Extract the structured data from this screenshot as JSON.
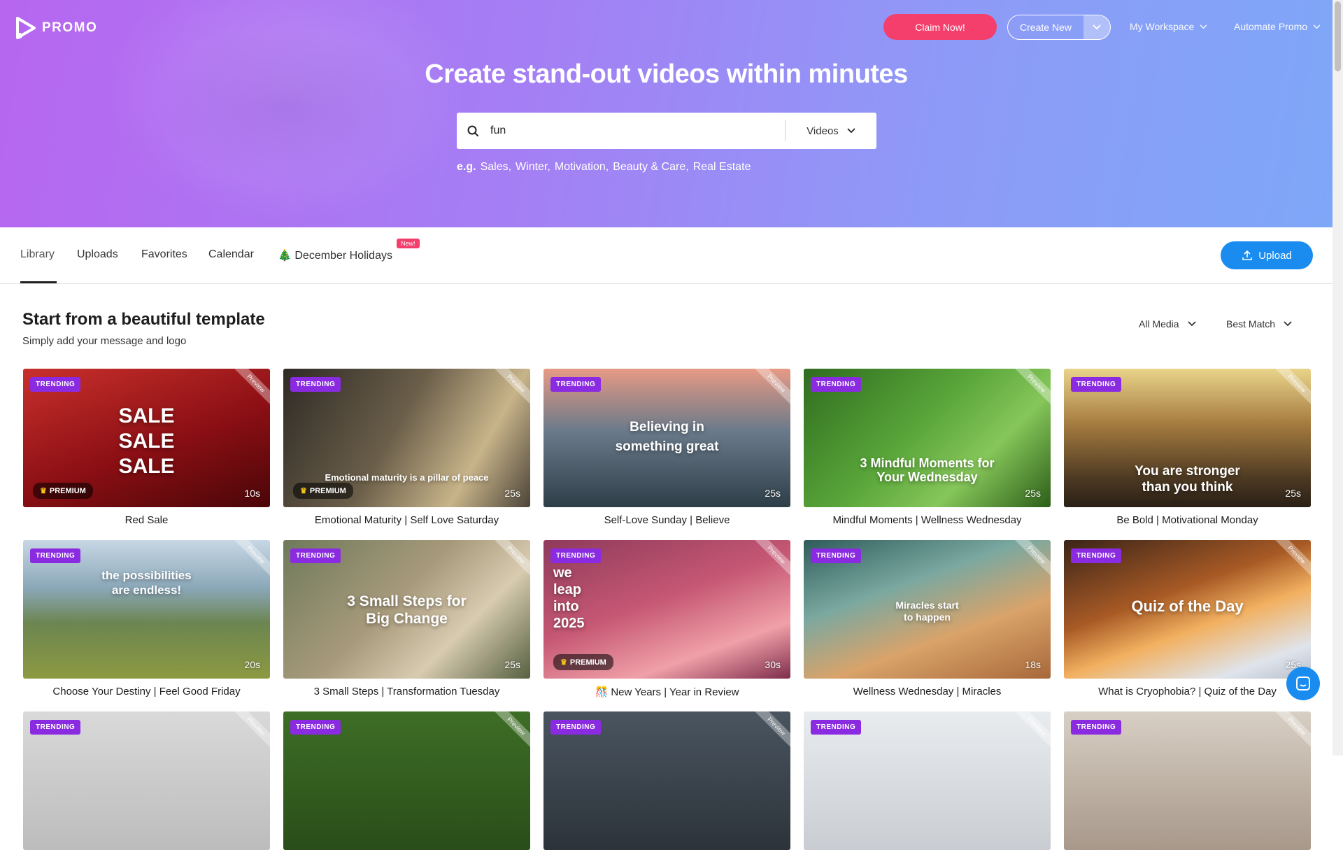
{
  "brand": {
    "name": "PROMO"
  },
  "header": {
    "claim": "Claim Now!",
    "create": "Create New",
    "workspace": "My Workspace",
    "automate": "Automate Promo"
  },
  "hero": {
    "title": "Create stand-out videos within minutes"
  },
  "search": {
    "value": "fun",
    "type": "Videos"
  },
  "examples": {
    "prefix": "e.g.",
    "items": [
      "Sales,",
      "Winter,",
      "Motivation,",
      "Beauty & Care,",
      "Real Estate"
    ]
  },
  "tabs": [
    {
      "label": "Library"
    },
    {
      "label": "Uploads"
    },
    {
      "label": "Favorites"
    },
    {
      "label": "Calendar"
    },
    {
      "label": "🎄 December Holidays"
    }
  ],
  "new_badge": "New!",
  "upload": "Upload",
  "section": {
    "title": "Start from a beautiful template",
    "subtitle": "Simply add your message and logo"
  },
  "filters": {
    "media": "All Media",
    "sort": "Best Match"
  },
  "badges": {
    "trending": "TRENDING",
    "premium": "PREMIUM",
    "preview": "Preview"
  },
  "templates": [
    {
      "title": "Red Sale",
      "duration": "10s",
      "overlay": "SALE\nSALE\nSALE",
      "premium": true,
      "bg": "linear-gradient(160deg,#c9302c 0%,#8b0f14 55%,#4a0608 100%)"
    },
    {
      "title": "Emotional Maturity | Self Love Saturday",
      "duration": "25s",
      "overlay": "Emotional maturity is a pillar of peace",
      "premium": true,
      "bg": "linear-gradient(120deg,#2e2a25 0%,#6b5f4a 45%,#c8b48a 75%,#4c4438 100%)"
    },
    {
      "title": "Self-Love Sunday | Believe",
      "duration": "25s",
      "overlay": "Believing in\nsomething great",
      "premium": false,
      "bg": "linear-gradient(180deg,#e79a85 0%,#6a7a8a 45%,#2e3e48 100%)"
    },
    {
      "title": "Mindful Moments | Wellness Wednesday",
      "duration": "25s",
      "overlay": "3 Mindful Moments for\nYour Wednesday",
      "premium": false,
      "bg": "linear-gradient(135deg,#2f6d1f 0%,#5aa63a 45%,#86c65a 70%,#2c5e18 100%)"
    },
    {
      "title": "Be Bold | Motivational Monday",
      "duration": "25s",
      "overlay": "You are stronger\nthan you think",
      "premium": false,
      "bg": "linear-gradient(180deg,#e9d48a 0%,#a57b3f 40%,#4b3822 80%,#2a2016 100%)"
    },
    {
      "title": "Choose Your Destiny | Feel Good Friday",
      "duration": "20s",
      "overlay": "the possibilities\nare endless!",
      "premium": false,
      "bg": "linear-gradient(180deg,#c7d7e4 0%,#8aa7b8 35%,#6c8550 60%,#8d9a42 100%)"
    },
    {
      "title": "3 Small Steps | Transformation Tuesday",
      "duration": "25s",
      "overlay": "3 Small Steps for\nBig Change",
      "premium": false,
      "bg": "linear-gradient(135deg,#6e7a5a 0%,#a89a7c 45%,#d8cbb0 70%,#556040 100%)"
    },
    {
      "title": "🎊 New Years | Year in Review",
      "duration": "30s",
      "overlay": "we\nleap\ninto\n2025",
      "premium": true,
      "bg": "linear-gradient(160deg,#8f3a5b 0%,#c65874 45%,#f0a0a8 75%,#7e2d4b 100%)"
    },
    {
      "title": "Wellness Wednesday | Miracles",
      "duration": "18s",
      "overlay": "Miracles start\nto happen",
      "premium": false,
      "bg": "linear-gradient(160deg,#2f5c5a 0%,#7aa8a0 35%,#d9a36a 65%,#a8683a 100%)"
    },
    {
      "title": "What is Cryophobia? | Quiz of the Day",
      "duration": "25s",
      "overlay": "Quiz of the Day",
      "premium": false,
      "bg": "linear-gradient(160deg,#3a2418 0%,#a85a25 40%,#f2b060 60%,#dfe4ec 85%,#b8c0cc 100%)"
    },
    {
      "title": "",
      "duration": "",
      "overlay": "",
      "premium": false,
      "bg": "linear-gradient(180deg,#d9d9d9 0%,#bcbcbc 100%)"
    },
    {
      "title": "",
      "duration": "",
      "overlay": "",
      "premium": false,
      "bg": "linear-gradient(180deg,#3d6e26 0%,#2a4d19 100%)"
    },
    {
      "title": "",
      "duration": "",
      "overlay": "",
      "premium": false,
      "bg": "linear-gradient(180deg,#4a5560 0%,#2c333a 100%)"
    },
    {
      "title": "",
      "duration": "",
      "overlay": "",
      "premium": false,
      "bg": "linear-gradient(180deg,#e9ecef 0%,#c9cdd2 100%)"
    },
    {
      "title": "",
      "duration": "",
      "overlay": "",
      "premium": false,
      "bg": "linear-gradient(180deg,#d8cfc4 0%,#a7988a 100%)"
    }
  ],
  "colors": {
    "accent": "#1a8cf0",
    "claim": "#f43f6c",
    "trending": "#8a2be2"
  }
}
